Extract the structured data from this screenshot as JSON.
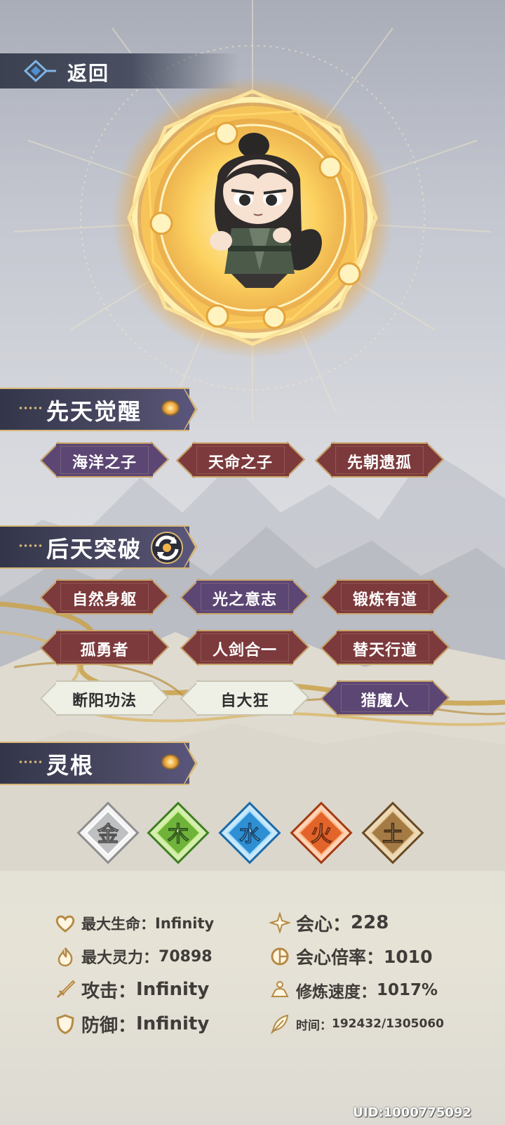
{
  "header": {
    "back_label": "返回"
  },
  "innate": {
    "title": "先天觉醒",
    "tags": [
      {
        "label": "海洋之子",
        "color": "purple"
      },
      {
        "label": "天命之子",
        "color": "red"
      },
      {
        "label": "先朝遗孤",
        "color": "red"
      }
    ]
  },
  "acquired": {
    "title": "后天突破",
    "tags": [
      {
        "label": "自然身躯",
        "color": "red"
      },
      {
        "label": "光之意志",
        "color": "purple"
      },
      {
        "label": "锻炼有道",
        "color": "red"
      },
      {
        "label": "孤勇者",
        "color": "red"
      },
      {
        "label": "人剑合一",
        "color": "red"
      },
      {
        "label": "替天行道",
        "color": "red"
      },
      {
        "label": "断阳功法",
        "color": "white"
      },
      {
        "label": "自大狂",
        "color": "white"
      },
      {
        "label": "猎魔人",
        "color": "purple"
      }
    ]
  },
  "spirit_root": {
    "title": "灵根",
    "elements": [
      {
        "char": "金",
        "color": "#bfc0c2"
      },
      {
        "char": "木",
        "color": "#6fb33a"
      },
      {
        "char": "水",
        "color": "#2f8fd3"
      },
      {
        "char": "火",
        "color": "#e2642a"
      },
      {
        "char": "土",
        "color": "#a47a45"
      }
    ]
  },
  "stats": {
    "max_hp_label": "最大生命：",
    "max_hp": "Infinity",
    "max_sp_label": "最大灵力：",
    "max_sp": "70898",
    "attack_label": "攻击：",
    "attack": "Infinity",
    "defense_label": "防御：",
    "defense": "Infinity",
    "crit_label": "会心：",
    "crit": "228",
    "crit_mult_label": "会心倍率：",
    "crit_mult": "1010",
    "cultivate_label": "修炼速度：",
    "cultivate": "1017%",
    "time_label": "时间：",
    "time": "192432/1305060"
  },
  "uid": "UID:1000775092"
}
